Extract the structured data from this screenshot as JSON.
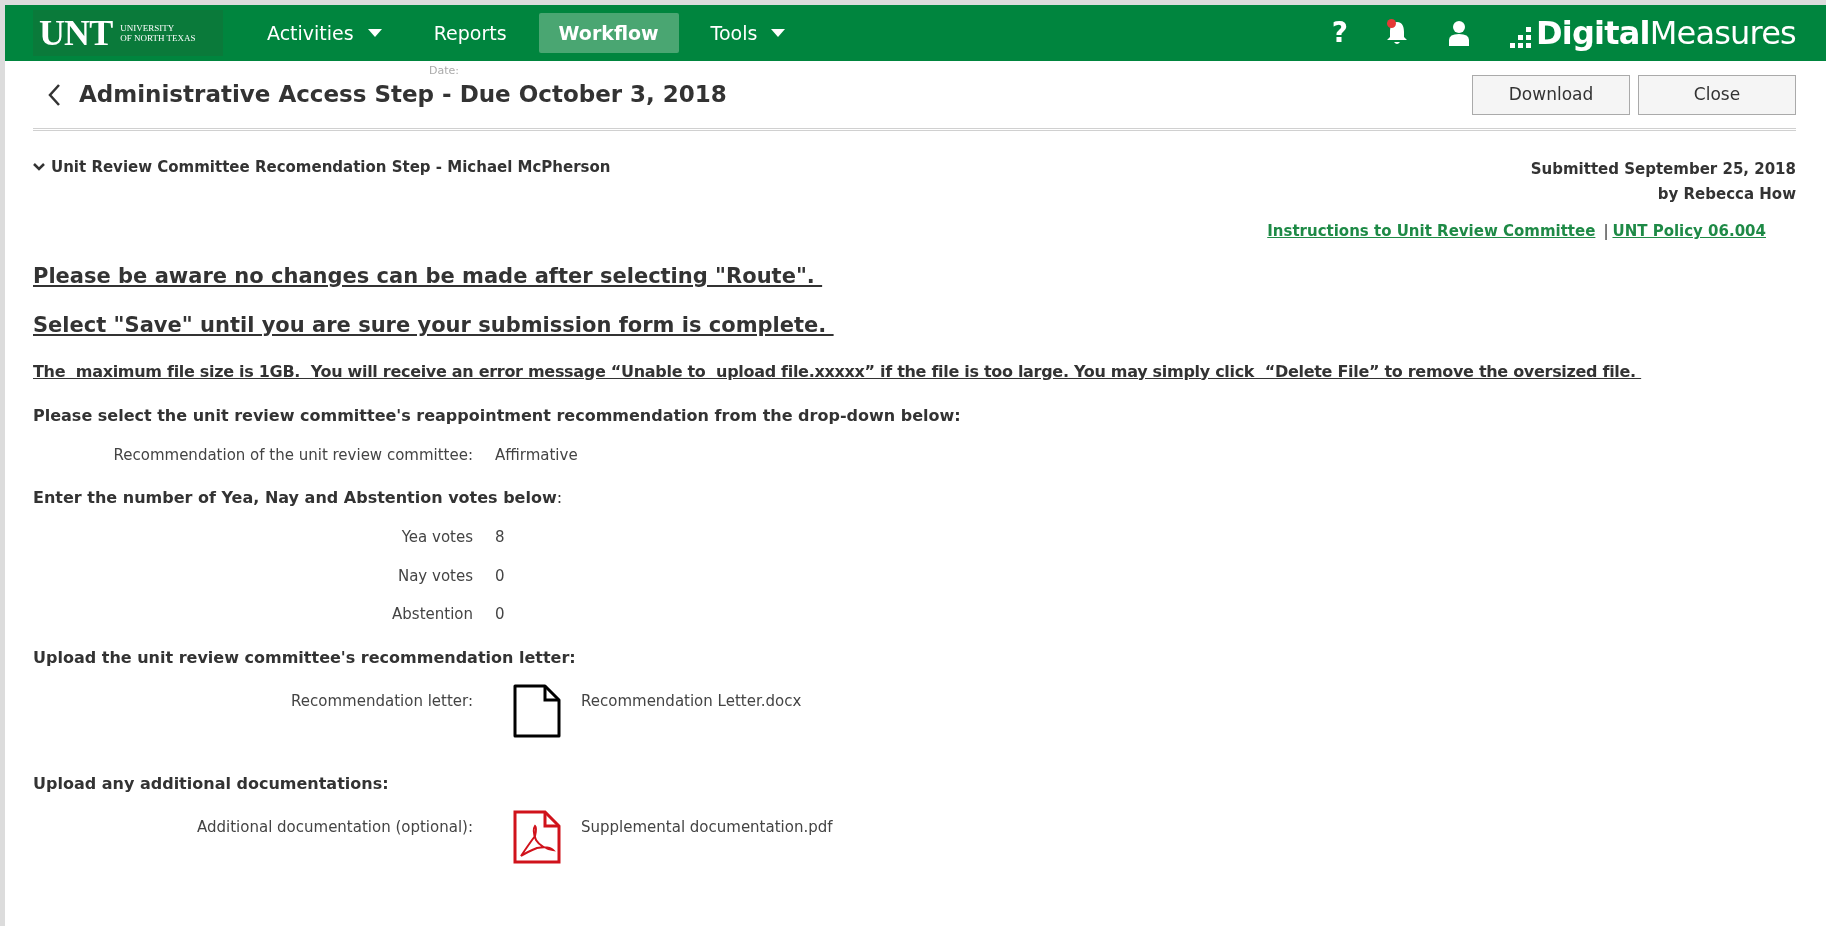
{
  "nav": {
    "logo": {
      "mark": "UNT",
      "sub_lines": [
        "UNIVERSITY",
        "OF NORTH TEXAS"
      ]
    },
    "items": [
      {
        "label": "Activities",
        "dropdown": true,
        "selected": false
      },
      {
        "label": "Reports",
        "dropdown": false,
        "selected": false
      },
      {
        "label": "Workflow",
        "dropdown": false,
        "selected": true
      },
      {
        "label": "Tools",
        "dropdown": true,
        "selected": false
      }
    ],
    "help": "?",
    "has_alert": true,
    "brand": "**Digital**Measures"
  },
  "page": {
    "title": "Administrative Access Step - Due October 3, 2018",
    "ghost_label": "Date:",
    "buttons": [
      "Download",
      "Close"
    ]
  },
  "section": {
    "title": "Unit Review Committee Recomendation Step - Michael McPherson",
    "expanded": true,
    "submitted": [
      "Submitted September 25, 2018",
      "by Rebecca How"
    ],
    "links": [
      "Instructions to Unit Review Committee",
      "UNT Policy 06.004"
    ],
    "separator": "|"
  },
  "notices": [
    {
      "kind": "large",
      "text": "Please be aware no changes can be made after selecting \"Route\". "
    },
    {
      "kind": "large",
      "text": "Select \"Save\" until you are sure your submission form is complete. "
    },
    {
      "kind": "small",
      "text": "The  maximum file size is 1GB.  You will receive an error message “Unable to  upload file.xxxxx” if the file is too large. You may simply click  “Delete File” to remove the oversized file. "
    }
  ],
  "blocks": [
    {
      "kind": "heading",
      "text": "**Please select the unit review committee's reappointment recommendation from the drop-down below:**"
    },
    {
      "kind": "field",
      "label": "Recommendation of the unit review committee:",
      "value": "Affirmative"
    },
    {
      "kind": "heading",
      "text": "**Enter the number of Yea, Nay and Abstention votes below**:"
    },
    {
      "kind": "field",
      "label": "Yea votes",
      "value": "8"
    },
    {
      "kind": "field",
      "label": "Nay votes",
      "value": "0"
    },
    {
      "kind": "field",
      "label": "Abstention",
      "value": "0"
    },
    {
      "kind": "heading",
      "text": "**Upload the unit review committee's recommendation letter:**"
    },
    {
      "kind": "file",
      "label": "Recommendation letter:",
      "pdf": false,
      "filename": "Recommendation Letter.docx"
    },
    {
      "kind": "heading",
      "text": "**Upload any additional documentations:**"
    },
    {
      "kind": "file",
      "label": "Additional documentation (optional):",
      "pdf": true,
      "filename": "Supplemental documentation.pdf"
    }
  ]
}
